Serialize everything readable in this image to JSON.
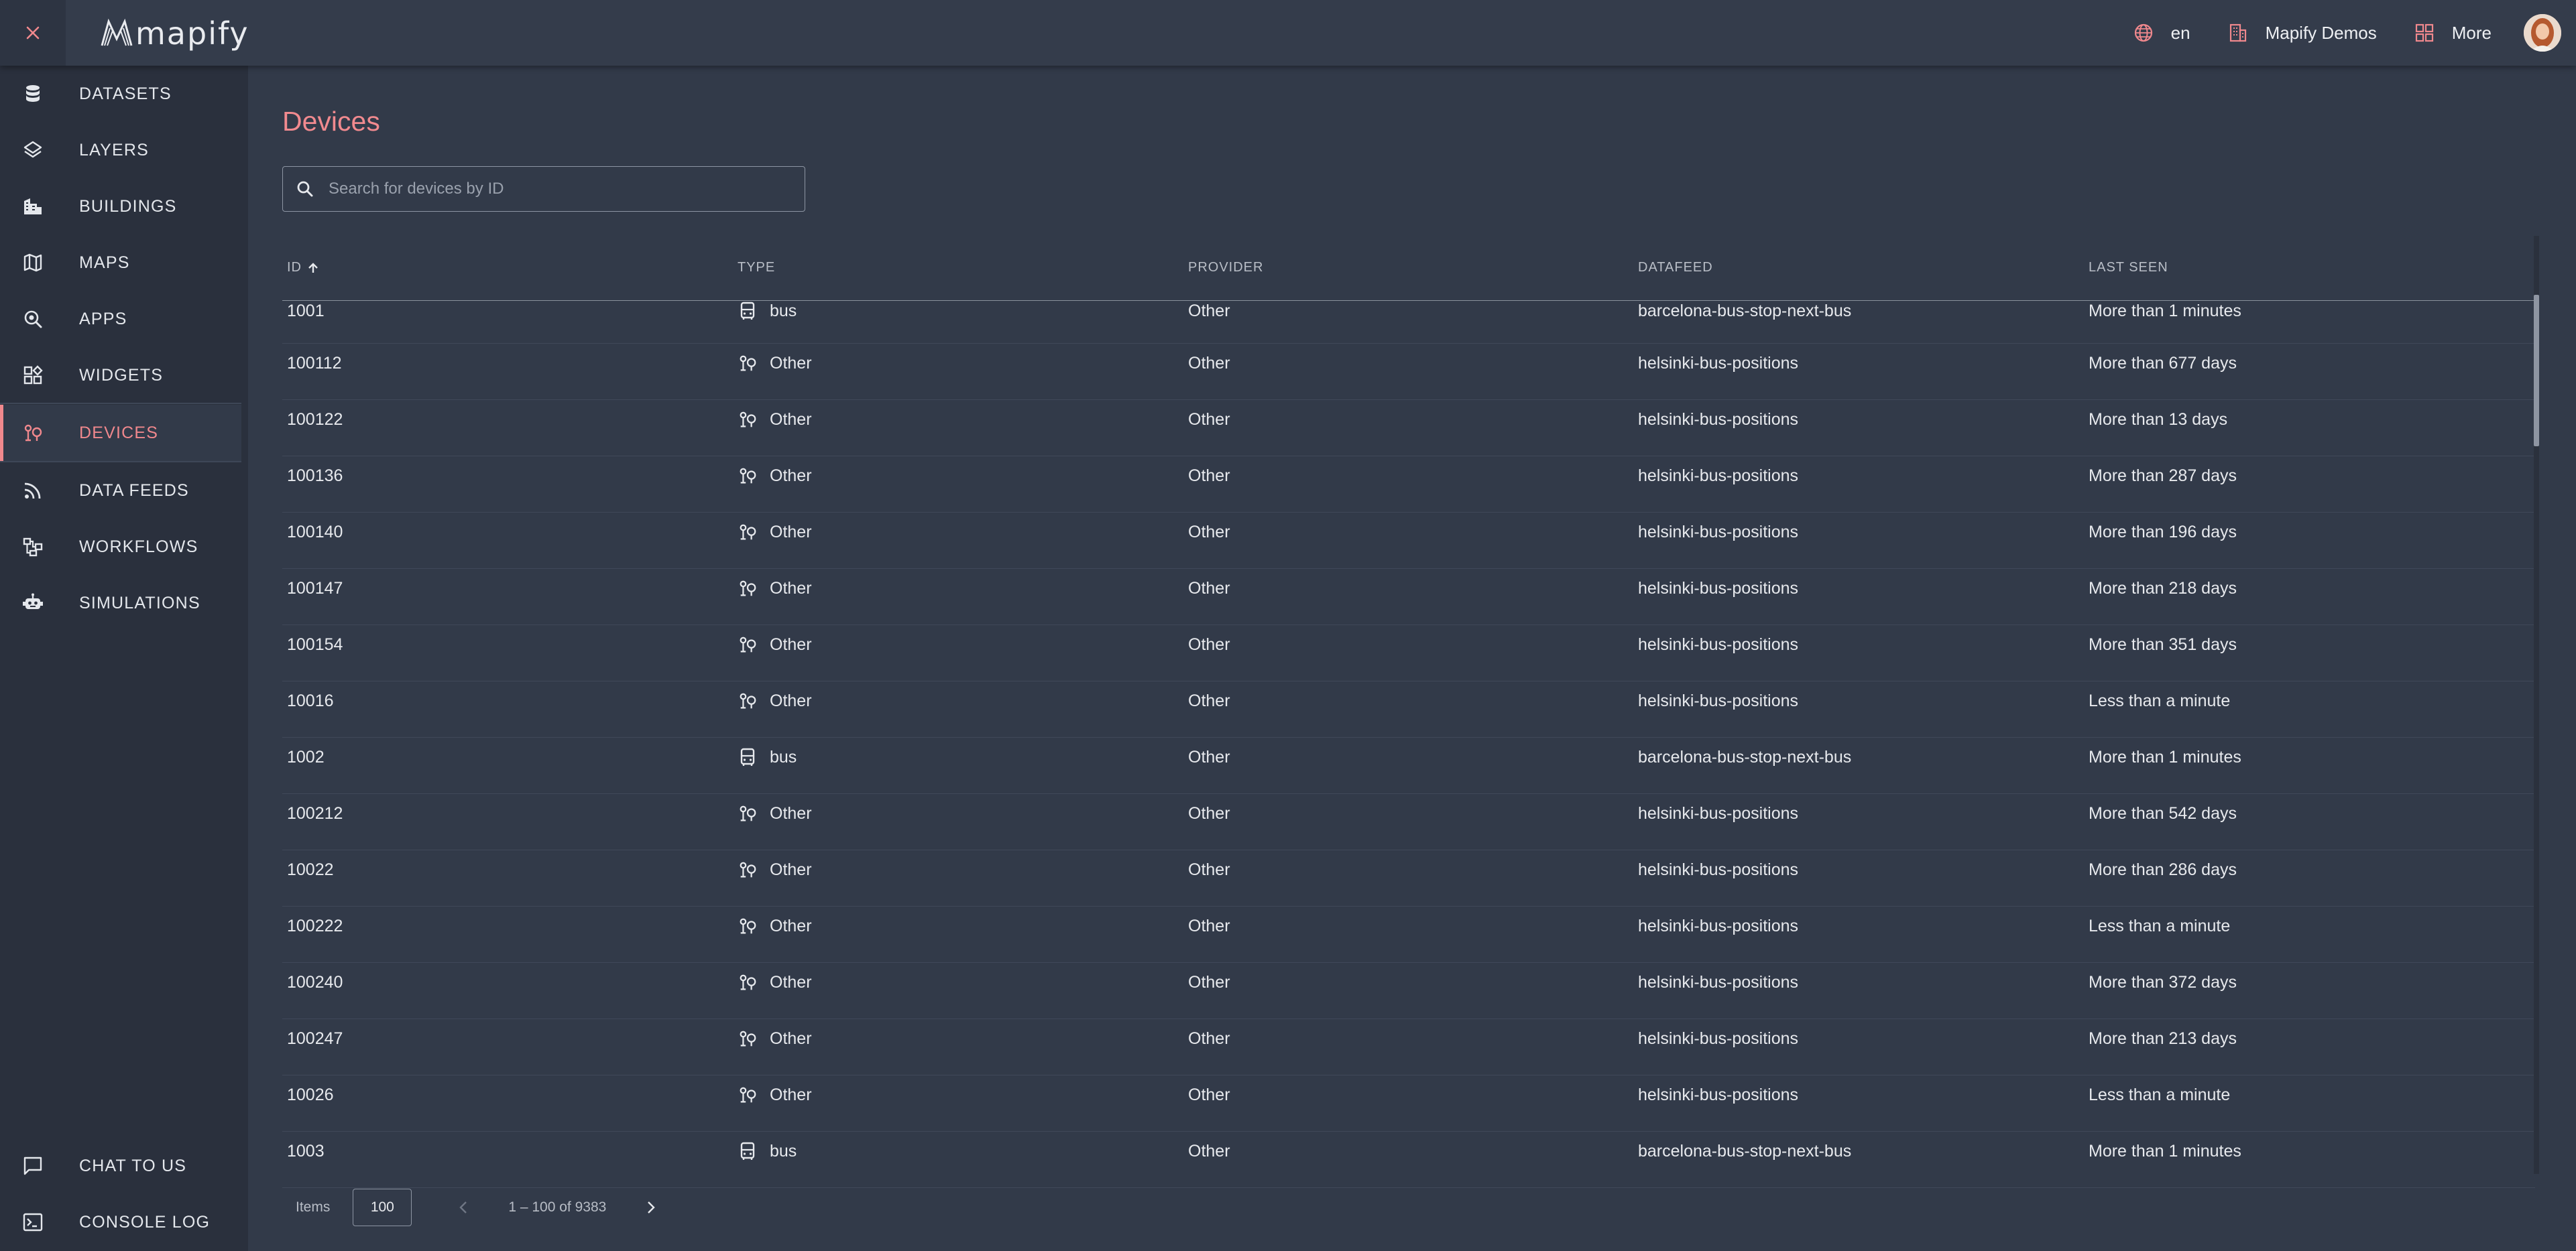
{
  "app": {
    "logo_text": "mapify",
    "language": "en",
    "organization": "Mapify Demos",
    "more_label": "More"
  },
  "sidebar": {
    "items": [
      {
        "label": "DATASETS",
        "icon": "database-icon"
      },
      {
        "label": "LAYERS",
        "icon": "layers-icon"
      },
      {
        "label": "BUILDINGS",
        "icon": "buildings-icon"
      },
      {
        "label": "MAPS",
        "icon": "map-icon"
      },
      {
        "label": "APPS",
        "icon": "apps-icon"
      },
      {
        "label": "WIDGETS",
        "icon": "widgets-icon"
      },
      {
        "label": "DEVICES",
        "icon": "devices-icon",
        "active": true
      },
      {
        "label": "DATA FEEDS",
        "icon": "rss-icon"
      },
      {
        "label": "WORKFLOWS",
        "icon": "workflow-icon"
      },
      {
        "label": "SIMULATIONS",
        "icon": "robot-icon"
      }
    ],
    "bottom": [
      {
        "label": "CHAT TO US",
        "icon": "chat-icon"
      },
      {
        "label": "CONSOLE LOG",
        "icon": "terminal-icon"
      }
    ]
  },
  "main": {
    "title": "Devices",
    "search_placeholder": "Search for devices by ID"
  },
  "table": {
    "columns": [
      "ID",
      "TYPE",
      "PROVIDER",
      "DATAFEED",
      "LAST SEEN"
    ],
    "sort_column": "ID",
    "sort_direction": "ascending",
    "rows": [
      {
        "id": "1001",
        "type": "bus",
        "provider": "Other",
        "datafeed": "barcelona-bus-stop-next-bus",
        "last_seen": "More than 1 minutes"
      },
      {
        "id": "100112",
        "type": "Other",
        "provider": "Other",
        "datafeed": "helsinki-bus-positions",
        "last_seen": "More than 677 days"
      },
      {
        "id": "100122",
        "type": "Other",
        "provider": "Other",
        "datafeed": "helsinki-bus-positions",
        "last_seen": "More than 13 days"
      },
      {
        "id": "100136",
        "type": "Other",
        "provider": "Other",
        "datafeed": "helsinki-bus-positions",
        "last_seen": "More than 287 days"
      },
      {
        "id": "100140",
        "type": "Other",
        "provider": "Other",
        "datafeed": "helsinki-bus-positions",
        "last_seen": "More than 196 days"
      },
      {
        "id": "100147",
        "type": "Other",
        "provider": "Other",
        "datafeed": "helsinki-bus-positions",
        "last_seen": "More than 218 days"
      },
      {
        "id": "100154",
        "type": "Other",
        "provider": "Other",
        "datafeed": "helsinki-bus-positions",
        "last_seen": "More than 351 days"
      },
      {
        "id": "10016",
        "type": "Other",
        "provider": "Other",
        "datafeed": "helsinki-bus-positions",
        "last_seen": "Less than a minute"
      },
      {
        "id": "1002",
        "type": "bus",
        "provider": "Other",
        "datafeed": "barcelona-bus-stop-next-bus",
        "last_seen": "More than 1 minutes"
      },
      {
        "id": "100212",
        "type": "Other",
        "provider": "Other",
        "datafeed": "helsinki-bus-positions",
        "last_seen": "More than 542 days"
      },
      {
        "id": "10022",
        "type": "Other",
        "provider": "Other",
        "datafeed": "helsinki-bus-positions",
        "last_seen": "More than 286 days"
      },
      {
        "id": "100222",
        "type": "Other",
        "provider": "Other",
        "datafeed": "helsinki-bus-positions",
        "last_seen": "Less than a minute"
      },
      {
        "id": "100240",
        "type": "Other",
        "provider": "Other",
        "datafeed": "helsinki-bus-positions",
        "last_seen": "More than 372 days"
      },
      {
        "id": "100247",
        "type": "Other",
        "provider": "Other",
        "datafeed": "helsinki-bus-positions",
        "last_seen": "More than 213 days"
      },
      {
        "id": "10026",
        "type": "Other",
        "provider": "Other",
        "datafeed": "helsinki-bus-positions",
        "last_seen": "Less than a minute"
      },
      {
        "id": "1003",
        "type": "bus",
        "provider": "Other",
        "datafeed": "barcelona-bus-stop-next-bus",
        "last_seen": "More than 1 minutes"
      }
    ]
  },
  "pagination": {
    "items_label": "Items",
    "page_size": "100",
    "range": "1 – 100 of 9383"
  },
  "colors": {
    "accent": "#f0888d",
    "background": "#323a49",
    "sidebar": "#2a303d"
  }
}
